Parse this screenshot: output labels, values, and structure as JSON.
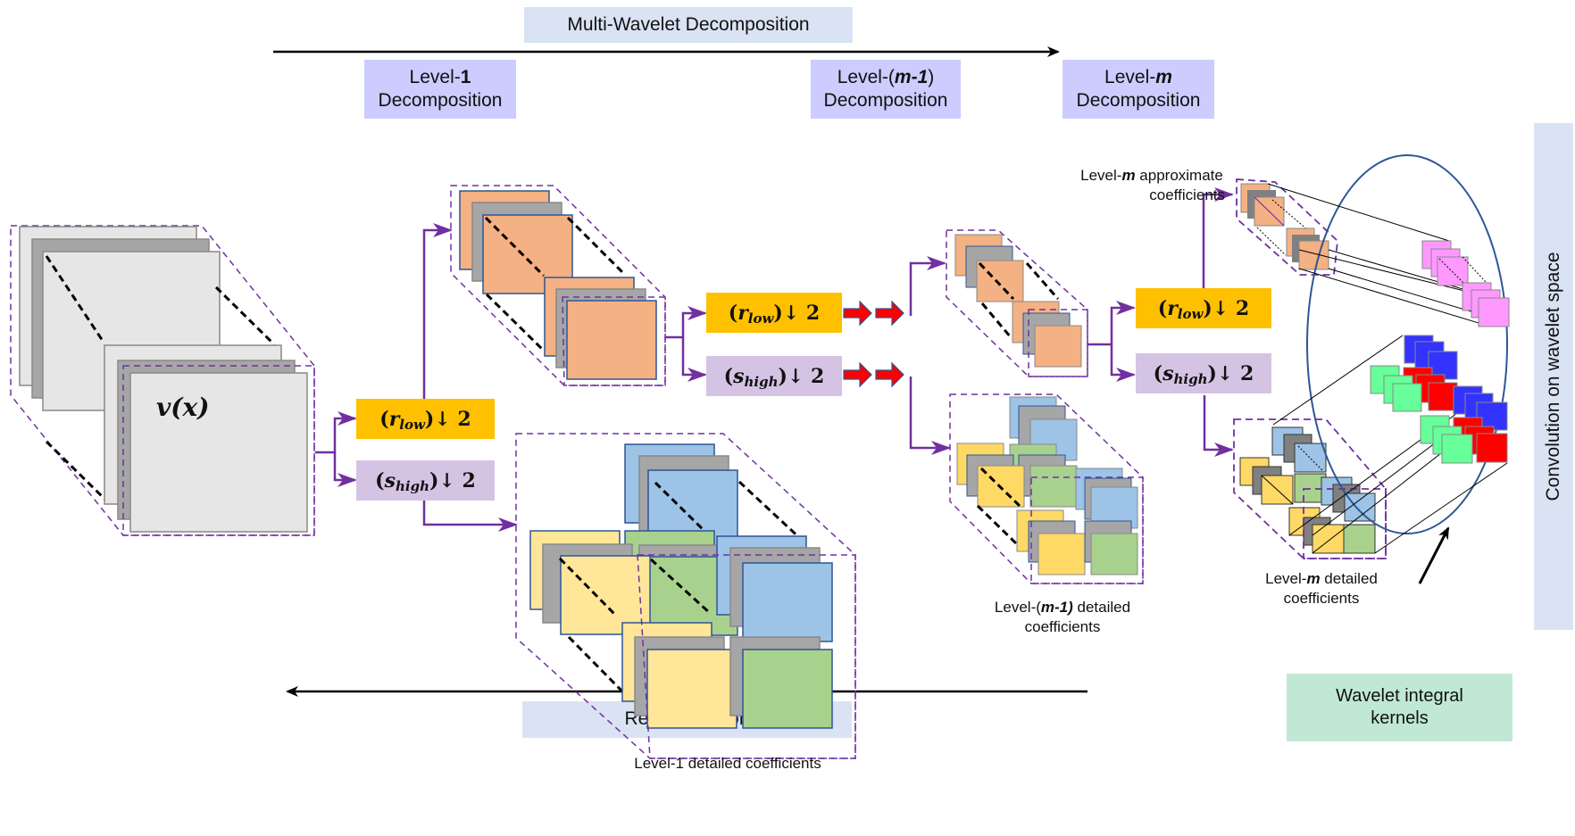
{
  "header": {
    "decomposition_label": "Multi-Wavelet Decomposition",
    "reconstruction_label": "Reconstruction"
  },
  "levels": [
    {
      "line1_prefix": "Level-",
      "line1_emph": "1",
      "line1_suffix": "",
      "line2": "Decomposition"
    },
    {
      "line1_prefix": "Level-(",
      "line1_emph": "m-1",
      "line1_suffix": ")",
      "line2": "Decomposition"
    },
    {
      "line1_prefix": "Level-",
      "line1_emph": "m",
      "line1_suffix": "",
      "line2": "Decomposition"
    }
  ],
  "input": {
    "label": "v(x)"
  },
  "operators": {
    "low": {
      "open": "(",
      "var": "r",
      "sub": "low",
      "close": ")",
      "op": " ↓ 2"
    },
    "high": {
      "open": "(",
      "var": "s",
      "sub": "high",
      "close": ")",
      "op": " ↓ 2"
    }
  },
  "captions": {
    "level1_detailed": "Level-1 detailed coefficients",
    "levelm1_detailed_l1_prefix": "Level-(",
    "levelm1_detailed_l1_emph": "m-1)",
    "levelm1_detailed_l1_suffix": " detailed",
    "levelm1_detailed_l2": "coefficients",
    "levelm_approx_l1_prefix": "Level-",
    "levelm_approx_l1_emph": "m",
    "levelm_approx_l1_suffix": " approximate",
    "levelm_approx_l2": "coefficients",
    "levelm_detailed_l1_prefix": "Level-",
    "levelm_detailed_l1_emph": "m",
    "levelm_detailed_l1_suffix": " detailed",
    "levelm_detailed_l2": "coefficients"
  },
  "kernels": {
    "line1": "Wavelet integral",
    "line2": "kernels"
  },
  "side_panel": {
    "label": "Convolution on wavelet space"
  },
  "colors": {
    "flow_arrow": "#7030a0",
    "low_box": "#ffc000",
    "high_box": "#d5c3e4",
    "level_box": "#ccccff",
    "header_box": "#dae3f3",
    "kernel_box": "#c0e8d4",
    "approx_tile": "#f4b183",
    "detail_blue": "#9dc3e6",
    "detail_yellow": "#ffe699",
    "detail_green": "#a9d18e",
    "gray_tile": "#a6a6a6",
    "input_tile": "#e6e6e6",
    "kernel_pink": "#ff99ff",
    "kernel_blue": "#3333ff",
    "kernel_red": "#ff0000",
    "kernel_green": "#66ff99",
    "ellipse": "#2f5597",
    "red_arrow": "#ff0000"
  }
}
